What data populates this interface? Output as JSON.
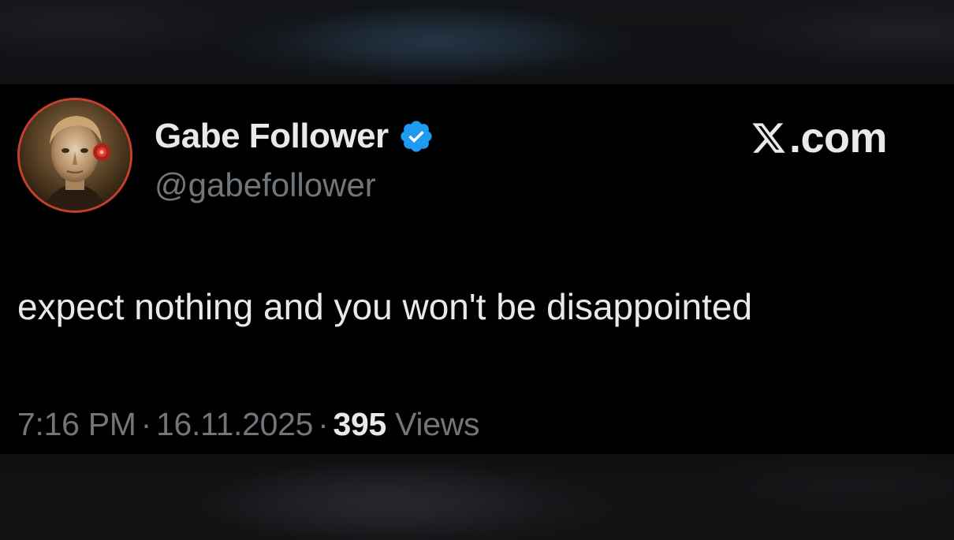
{
  "author": {
    "display_name": "Gabe Follower",
    "handle": "@gabefollower",
    "verified": true,
    "avatar_icon": "profile-portrait",
    "avatar_border_color": "#c4402c"
  },
  "brand": {
    "logo_icon": "x-logo-icon",
    "suffix": ".com"
  },
  "tweet": {
    "text": "expect nothing and you won't be disappointed"
  },
  "meta": {
    "time": "7:16 PM",
    "separator": "·",
    "date": "16.11.2025",
    "views_count": "395",
    "views_label": "Views"
  },
  "colors": {
    "background": "#000000",
    "primary_text": "#e7e9ea",
    "secondary_text": "#71767b",
    "verified_badge": "#1d9bf0"
  }
}
